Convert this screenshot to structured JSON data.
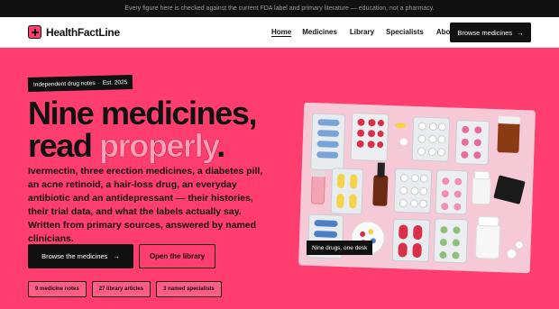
{
  "topbar": {
    "notice": "Every figure here is checked against the current FDA label and primary literature — education, not a pharmacy."
  },
  "nav": {
    "brand": "HealthFactLine",
    "brand_icon": "plus-icon",
    "links": [
      "Home",
      "Medicines",
      "Library",
      "Specialists",
      "About"
    ],
    "active_link": "Home",
    "cta_label": "Browse medicines",
    "cta_icon": "arrow-right-icon"
  },
  "hero": {
    "eyebrow_tag": "Independent drug notes",
    "eyebrow_sep": "·",
    "eyebrow_year": "Est. 2025",
    "headline_line1": "Nine medicines,",
    "headline_line2_plain": "read ",
    "headline_line2_accent": "properly",
    "headline_line2_end": ".",
    "lede": "Ivermectin, three erection medicines, a diabetes pill, an acne retinoid, a hair-loss drug, an everyday antibiotic and an antidepressant — their histories, their trial data, and what the labels actually say. Written from primary sources, answered by named clinicians.",
    "primary_button": "Browse the medicines",
    "primary_button_icon": "arrow-right-icon",
    "secondary_button": "Open the library",
    "stats": [
      "9 medicine notes",
      "27 library articles",
      "3 named specialists"
    ],
    "image_caption": "Nine drugs, one desk"
  },
  "colors": {
    "brand_pink": "#ff3d6e",
    "ink": "#111111",
    "accent_light": "#ff9fb8"
  }
}
